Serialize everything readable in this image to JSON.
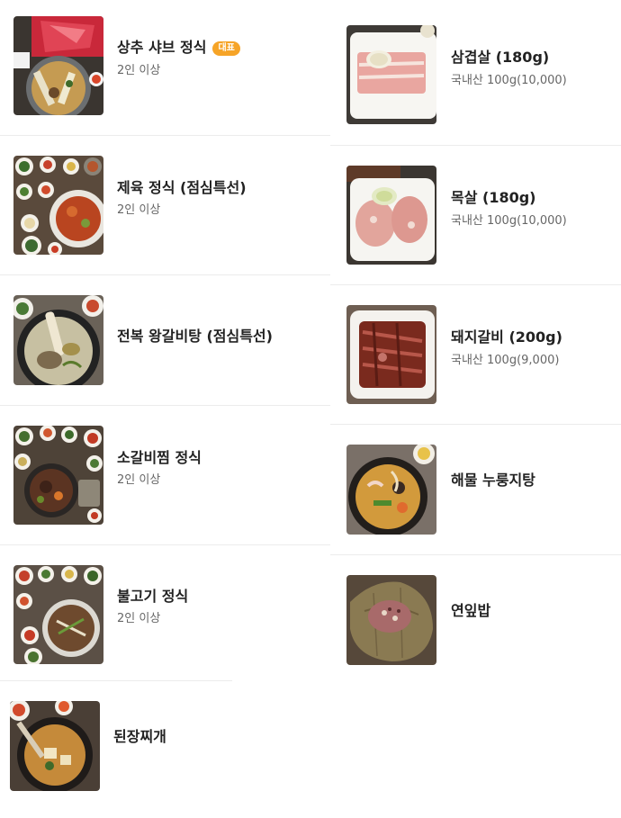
{
  "left_column": [
    {
      "name": "상추 샤브 정식",
      "badge": "대표",
      "detail": "2인 이상",
      "image": "shabu-hotpot-photo"
    },
    {
      "name": "제육 정식 (점심특선)",
      "detail": "2인 이상",
      "image": "spicy-pork-set-photo"
    },
    {
      "name": "전복 왕갈비탕 (점심특선)",
      "image": "abalone-galbitang-photo"
    },
    {
      "name": "소갈비찜 정식",
      "detail": "2인 이상",
      "image": "braised-short-ribs-photo"
    },
    {
      "name": "불고기 정식",
      "detail": "2인 이상",
      "image": "bulgogi-set-photo"
    },
    {
      "name": "된장찌개",
      "image": "doenjang-stew-photo"
    }
  ],
  "right_column": [
    {
      "name": "삼겹살 (180g)",
      "detail": "국내산 100g(10,000)",
      "image": "pork-belly-photo"
    },
    {
      "name": "목살 (180g)",
      "detail": "국내산 100g(10,000)",
      "image": "pork-neck-photo"
    },
    {
      "name": "돼지갈비 (200g)",
      "detail": "국내산 100g(9,000)",
      "image": "pork-galbi-photo"
    },
    {
      "name": "해물 누룽지탕",
      "image": "seafood-nurungji-photo"
    },
    {
      "name": "연잎밥",
      "image": "lotus-leaf-rice-photo"
    }
  ]
}
